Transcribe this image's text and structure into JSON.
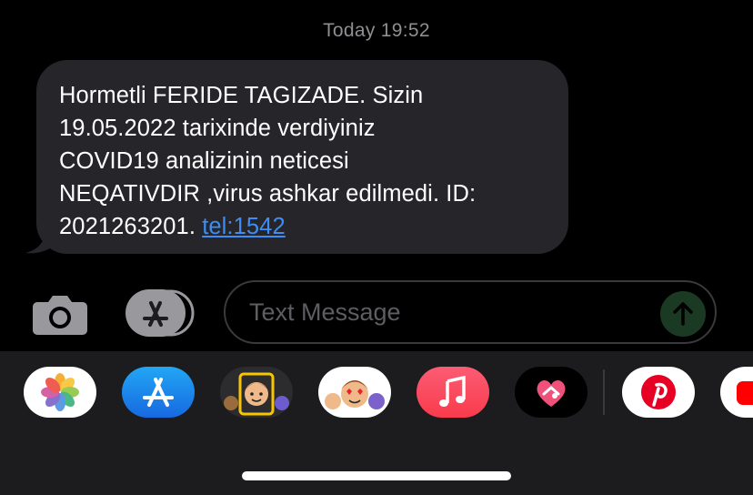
{
  "timestamp": "Today 19:52",
  "message": {
    "text": "Hormetli FERIDE TAGIZADE. Sizin\n19.05.2022 tarixinde verdiyiniz\nCOVID19 analizinin neticesi\nNEQATIVDIR ,virus ashkar edilmedi. ID:\n2021263201. ",
    "link": "tel:1542"
  },
  "compose": {
    "placeholder": "Text Message"
  },
  "app_drawer": {
    "apps": [
      "photos-icon",
      "app-store-icon",
      "memoji-icon",
      "animoji-stickers-icon",
      "music-icon",
      "digital-touch-icon",
      "pinterest-icon",
      "youtube-icon"
    ]
  },
  "colors": {
    "bubble": "#26252a",
    "link": "#3d8df5",
    "drawer": "#1c1c1e",
    "send_button": "#1a3a23"
  }
}
